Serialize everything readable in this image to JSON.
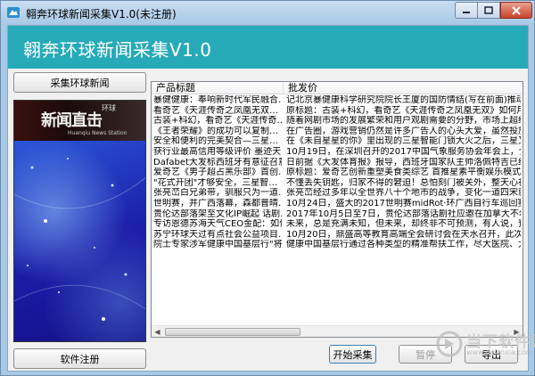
{
  "window": {
    "title": "翱奔环球新闻采集V1.0(未注册)"
  },
  "header": {
    "title": "翱奔环球新闻采集V1.0"
  },
  "sidebar": {
    "collect_button": "采集环球新闻",
    "register_button": "软件注册",
    "banner": {
      "logo_text": "新闻直击",
      "small_text": "环球",
      "tag_text": "Huanqiu News Station"
    }
  },
  "table": {
    "columns": [
      "产品标题",
      "批发价"
    ],
    "rows": [
      [
        "暴健健康：奉响新时代军民融合…",
        "记北京暴健康科学研究院院长王厦的国防情结(写在前面)推动"
      ],
      [
        "看奇艺《天涯传奇之凤凰无双…",
        "原标题：古装+科幻，看奇艺《天涯传奇之凤凰无双》如何用小成本"
      ],
      [
        "古装+科幻，看奇艺《天涯传奇…",
        "随着网剧市场的发展繁荣和用户观剧需要的分野，市场上超级IP网剧"
      ],
      [
        "《王者荣耀》的成功可以复制…",
        "在广告圈，游戏营销仍然是许多广告人的心头大爱，虽然投放量多"
      ],
      [
        "安全和便利的完美契合—三星…",
        "在《未自星星的你》里出现的三星智能门锁大火之后，三星又推出了"
      ],
      [
        "获行业最高信用等级评价 墨迹天…",
        "10月19日，在深圳召开的2017中国气象服务协会年会上，全球最大天"
      ],
      [
        "Dafabet大发标西班牙有意征召意…",
        "日前据《大发体育报》报导，西班牙国家队主帅洛佩特吉已经向意大"
      ],
      [
        "爱奇艺《男子超占黑乐部》首创…",
        "原标题：爱奇艺创新重塑美食类综艺 首推星素平衡娱乐模式如今，所"
      ],
      [
        "\"花式开团\"才够安全，三星智…",
        "不懂丢失钥匙，归家不得的窘迫！总怕刻门被关外，整天心神不宁的"
      ],
      [
        "张亮峦白兄弟带，驯服只为一道…",
        "张亮峦经过多年以全世界八十个地市的战争，变化一道四宋就成为了"
      ],
      [
        "世明赛，并广西落幕，森都普晴…",
        "10月24日，盛大的2017世明赛midRot·环广西自行车巡回赛落幕，环广"
      ],
      [
        "贵伦达部落架至文化IP崛起 话剧…",
        "2017年10月5日至7日，贵伦达部落话剧社应邀在加拿大不尔加里，埃"
      ],
      [
        "专访恩德苏海天气CEO金配：如何找钱…",
        "未来，总是充满未知，但未来，却终非不可预测，有人说，预见未来"
      ],
      [
        "苏宁环球天过有点社会公益项目…",
        "10月20日，鼎盛高等教育高端全会研讨会在天水召开，此次研讨会于"
      ],
      [
        "院士专家涉军健康中国基层行\"将…",
        "健康中国基层行通过各种类型的精准帮扶工作，尽大医院、大专家的"
      ]
    ]
  },
  "buttons": {
    "start": "开始采集",
    "pause": "暂停",
    "export": "导出"
  },
  "watermark": {
    "main": "当下软件园",
    "sub": "www.downxia.com"
  }
}
